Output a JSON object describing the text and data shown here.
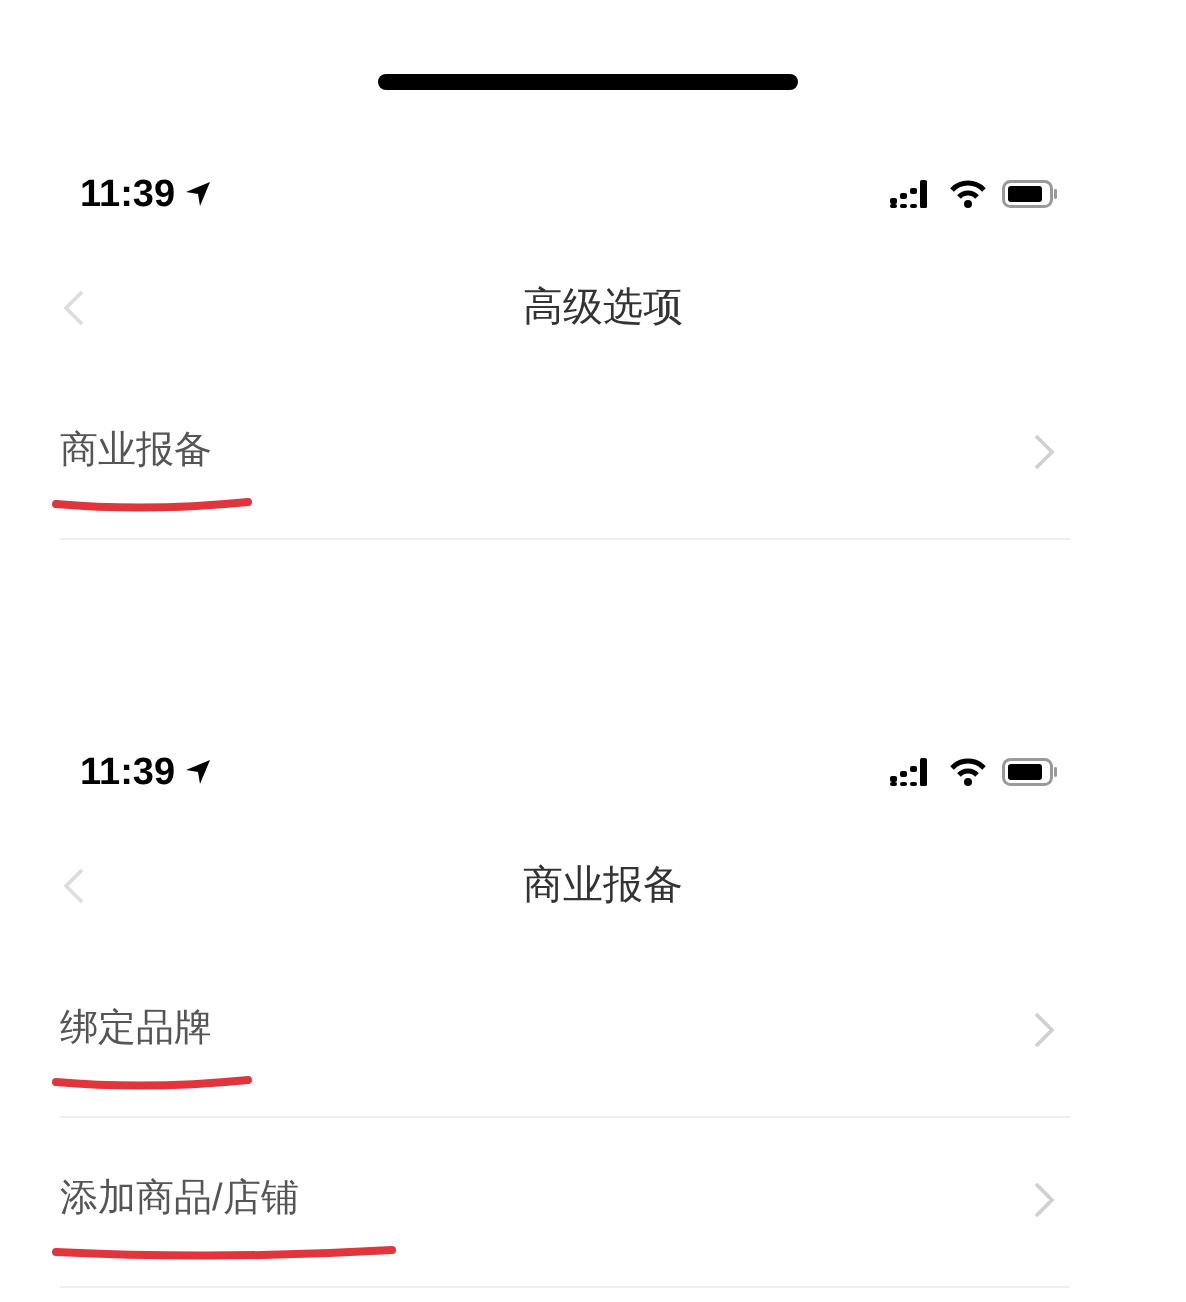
{
  "screens": [
    {
      "status_bar": {
        "time": "11:39"
      },
      "title": "高级选项",
      "rows": [
        {
          "label": "商业报备",
          "underlined": true
        }
      ]
    },
    {
      "status_bar": {
        "time": "11:39"
      },
      "title": "商业报备",
      "rows": [
        {
          "label": "绑定品牌",
          "underlined": true
        },
        {
          "label": "添加商品/店铺",
          "underlined": true
        }
      ]
    }
  ]
}
